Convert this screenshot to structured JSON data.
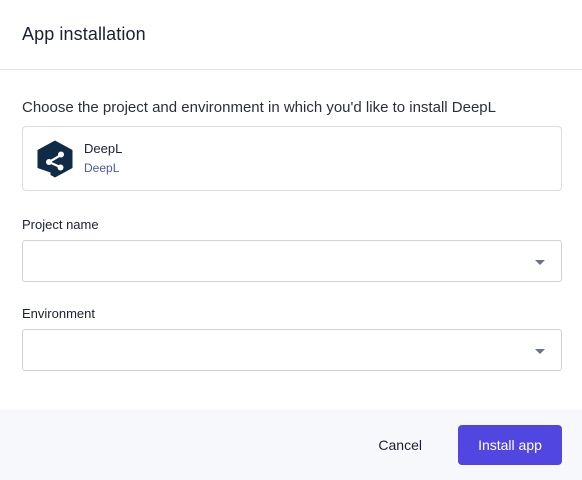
{
  "dialog": {
    "title": "App installation"
  },
  "intro": "Choose the project and environment in which you'd like to install DeepL",
  "app": {
    "name": "DeepL",
    "subtitle": "DeepL",
    "icon": "deepl-logo-icon",
    "logo_color": "#0f2b46"
  },
  "fields": {
    "project": {
      "label": "Project name",
      "value": "",
      "icon": "chevron-down-icon"
    },
    "environment": {
      "label": "Environment",
      "value": "",
      "icon": "chevron-down-icon"
    }
  },
  "footer": {
    "cancel_label": "Cancel",
    "install_label": "Install app",
    "accent": "#5146e0"
  }
}
